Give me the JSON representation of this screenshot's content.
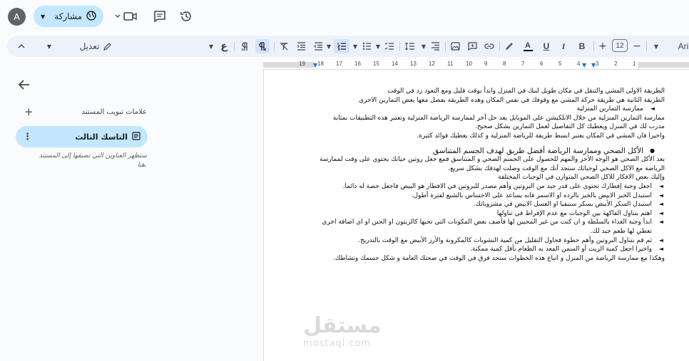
{
  "topbar": {
    "avatar_letter": "A",
    "share_label": "مشاركة",
    "icons": [
      "globe-icon",
      "video-call-icon",
      "comment-icon",
      "history-icon"
    ]
  },
  "toolbar": {
    "font_name": "Ari",
    "font_size": "12",
    "mode_label": "تعديل",
    "rtl_symbol": "ع"
  },
  "ruler": {
    "numbers": [
      "1",
      "2",
      "3",
      "4",
      "5",
      "6",
      "7",
      "8",
      "9",
      "10",
      "11",
      "12",
      "13",
      "14",
      "15",
      "16",
      "17",
      "18",
      "19"
    ]
  },
  "sidebar": {
    "outline_title": "علامات تبويب المستند",
    "tab_name": "التاسك الثالث",
    "hint": "ستظهر العناوين التي تضيفها إلى المستند هنا."
  },
  "document": {
    "paragraphs": [
      {
        "kind": "p",
        "text": "الطريقة الاولى المشي والتنقل في مكان طويل لنبك في المنزل وابدأ بوقت قليل ومع التعود زد في الوقت"
      },
      {
        "kind": "p",
        "text": "الطريقة الثانية هي طريقة حركة المشي مع وقوفك في نفس المكان وهذه الطريقة بفضل معها بعض التمارين الاخرى"
      },
      {
        "kind": "bul",
        "text": "ممارسة التمارين المنزلية"
      },
      {
        "kind": "p",
        "text": "ممارسة التمارين المنزلية من خلال الانلكيشن على الموبايل يعد حل آخر لممارسة الرياضة المنزلية وتعتبر هذه التطبيقات بمثابة مدرب لك في المنزل ويعطيك كل التفاصيل لعمل التمارين بشكل صحيح."
      },
      {
        "kind": "p",
        "text": "واخيرا فان المشي في المكان يعتبر ابسط طريقة للرياضة المنزلية و كذلك يعطيك فوائد كثيرة."
      },
      {
        "kind": "heading",
        "text": "الأكل الصحي وممارسة الرياضة أفضل طريق لهدف الجسم المتناسق"
      },
      {
        "kind": "p",
        "text": "يعد الأكل الصحي هو الوجه الأخر والمهم للحصول على الجسم الصحي و المتناسق فمع جعل روتين حياتك يحتوي على وقت لممارسة الرياضة مع الاكل الصحي لوجباتك ستجد أنك مع الوقت وصلت لهدفك بشكل سريع."
      },
      {
        "kind": "p",
        "text": "وإليك بعض الافكار للاكل الصحي المتوازن في الوجبات المختلفة"
      },
      {
        "kind": "bul2",
        "text": "اجعل وجبة إفطارك تحتوي على قدر جيد من البروتين وأهم مصدر للبروتين في الافطار هو البيض فاجعل حصة له دائما."
      },
      {
        "kind": "bul2",
        "text": "استبدل الخبز الابيض بالخبز بالرده او الاسمر فانه يساعد على الاحساس بالشبع لفترة أطول."
      },
      {
        "kind": "bul2",
        "text": "استبدل السكر الأبيض بسكر ستيفيا او العسل الابيض في مشروباتك."
      },
      {
        "kind": "bul2",
        "text": "اهتم بتناول الفاكهة بين الوجبات مع عدم الإفراط في تناولها"
      },
      {
        "kind": "bul2",
        "text": "ابدأ وجبة الغذاء بالسلطة و ان كنت من غير المحبين لها فأضف بعض المكونات التي تحبها كالزيتون او الجبن او اي اضافة اخرى تعطي لها طعم جيد لك."
      },
      {
        "kind": "bul2",
        "text": "ثم قم بتناول البروتين وأهم خطوة فحاول التقليل من كمية النشويات كالمكرونة والأرز الأبيض مع الوقت بالتدريج."
      },
      {
        "kind": "bul2",
        "text": "واخيرا اجعل كمية الزيت أو السمن المعد به الطعام بأقل كمية ممكنة."
      },
      {
        "kind": "p",
        "text": "وهكذا مع ممارسة الرياضة من المنزل و اتباع هذه الخطوات ستجد فرق في الوقت في صحتك العامة و شكل جسمك ونشاطك."
      }
    ]
  },
  "watermark": {
    "arabic": "مستقل",
    "latin": "mostaql.com"
  }
}
